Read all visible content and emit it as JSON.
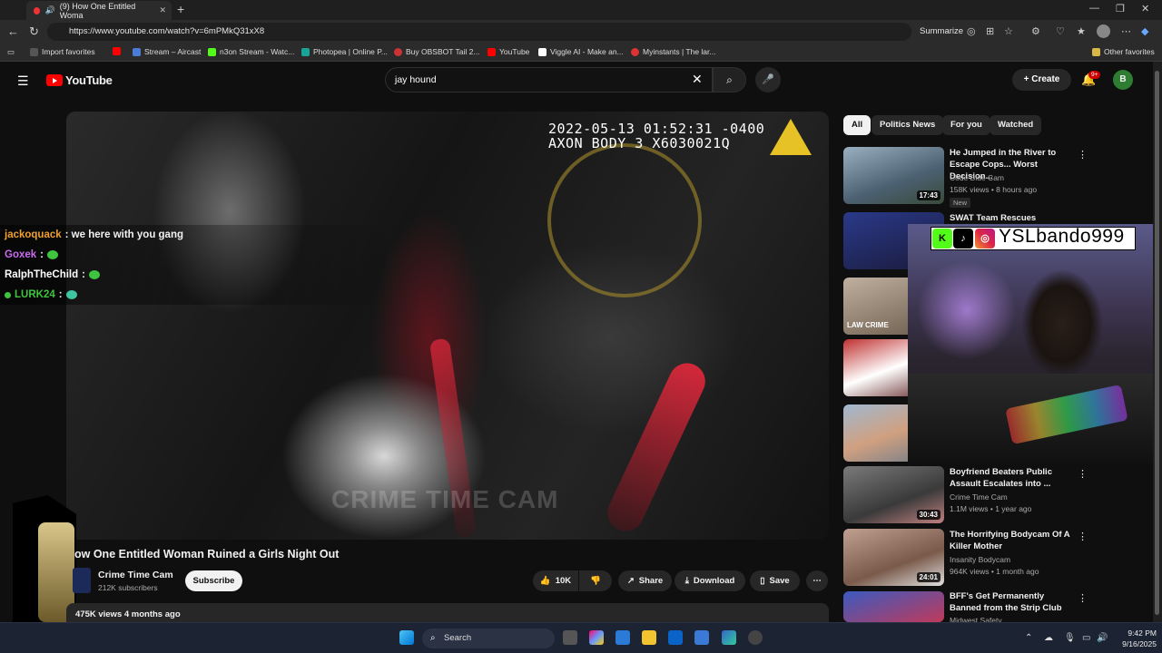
{
  "browser": {
    "tab_title": "(9) How One Entitled Woma",
    "url": "https://www.youtube.com/watch?v=6mPMkQ31xX8",
    "summarize_label": "Summarize",
    "bookmarks": [
      {
        "label": "Import favorites",
        "color": "#555"
      },
      {
        "label": "Stream – Aircast",
        "color": "#4a7bd6"
      },
      {
        "label": "n3on Stream - Watc...",
        "color": "#53fc18"
      },
      {
        "label": "Photopea | Online P...",
        "color": "#18a497"
      },
      {
        "label": "Buy OBSBOT Tail 2...",
        "color": "#c33"
      },
      {
        "label": "YouTube",
        "color": "#ff0000"
      },
      {
        "label": "Viggle AI - Make an...",
        "color": "#fff"
      },
      {
        "label": "Myinstants | The lar...",
        "color": "#d33"
      }
    ],
    "other_favorites": "Other favorites"
  },
  "youtube": {
    "logo_text": "YouTube",
    "search_value": "jay hound",
    "create_label": "Create",
    "notif_count": "9+",
    "avatar_letter": "B"
  },
  "video": {
    "timestamp_line1": "2022-05-13 01:52:31 -0400",
    "timestamp_line2": "AXON BODY 3 X6030021Q",
    "watermark": "CRIME TIME CAM",
    "title": "ow One Entitled Woman Ruined a Girls Night Out",
    "channel": "Crime Time Cam",
    "subscribers": "212K subscribers",
    "subscribe_label": "Subscribe",
    "likes": "10K",
    "share_label": "Share",
    "download_label": "Download",
    "save_label": "Save",
    "views_line": "475K views  4 months ago"
  },
  "chat": [
    {
      "user": "jackoquack",
      "color": "#f0a030",
      "message": ": we here with you gang",
      "emote": false,
      "dot": false
    },
    {
      "user": "Goxek",
      "color": "#c86cf0",
      "message": ":",
      "emote": true,
      "dot": false
    },
    {
      "user": "RalphTheChild",
      "color": "#ffffff",
      "message": ":",
      "emote": true,
      "dot": false
    },
    {
      "user": "LURK24",
      "color": "#3ec43e",
      "message": ":",
      "emote": true,
      "dot": true
    }
  ],
  "filters": [
    "All",
    "Politics News",
    "For you",
    "Watched"
  ],
  "recommendations": [
    {
      "title": "He Jumped in the River to Escape Cops... Worst Decision...",
      "channel": "Code Blue Cam",
      "meta": "158K views • 8 hours ago",
      "duration": "17:43",
      "new": "New",
      "thumb": "#5b7a8a"
    },
    {
      "title": "SWAT Team Rescues Hostages",
      "channel": "",
      "meta": "",
      "duration": "",
      "new": "",
      "thumb": "#2a3a7a"
    },
    {
      "title": "",
      "channel": "",
      "meta": "",
      "duration": "",
      "new": "",
      "thumb": "#8a7a6a",
      "thumb_text": "LAW CRIME"
    },
    {
      "title": "",
      "channel": "",
      "meta": "",
      "duration": "",
      "new": "",
      "thumb": "#7a2a2a"
    },
    {
      "title": "",
      "channel": "",
      "meta": "",
      "duration": "",
      "new": "",
      "thumb": "#8aa0b0"
    },
    {
      "title": "Boyfriend Beaters Public Assault Escalates into ...",
      "channel": "Crime Time Cam",
      "meta": "1.1M views • 1 year ago",
      "duration": "30:43",
      "new": "",
      "thumb": "#6a6a6a"
    },
    {
      "title": "The Horrifying Bodycam Of A Killer Mother",
      "channel": "Insanity Bodycam",
      "meta": "964K views • 1 month ago",
      "duration": "24:01",
      "new": "",
      "thumb": "#9a7a6a"
    },
    {
      "title": "BFF's Get Permanently Banned from the Strip Club",
      "channel": "Midwest Safety",
      "meta": "",
      "duration": "",
      "new": "",
      "thumb": "#3a4aa0"
    }
  ],
  "webcam": {
    "handle": "YSLbando999"
  },
  "taskbar": {
    "search_placeholder": "Search",
    "time": "9:42 PM",
    "date": "9/16/2025"
  }
}
